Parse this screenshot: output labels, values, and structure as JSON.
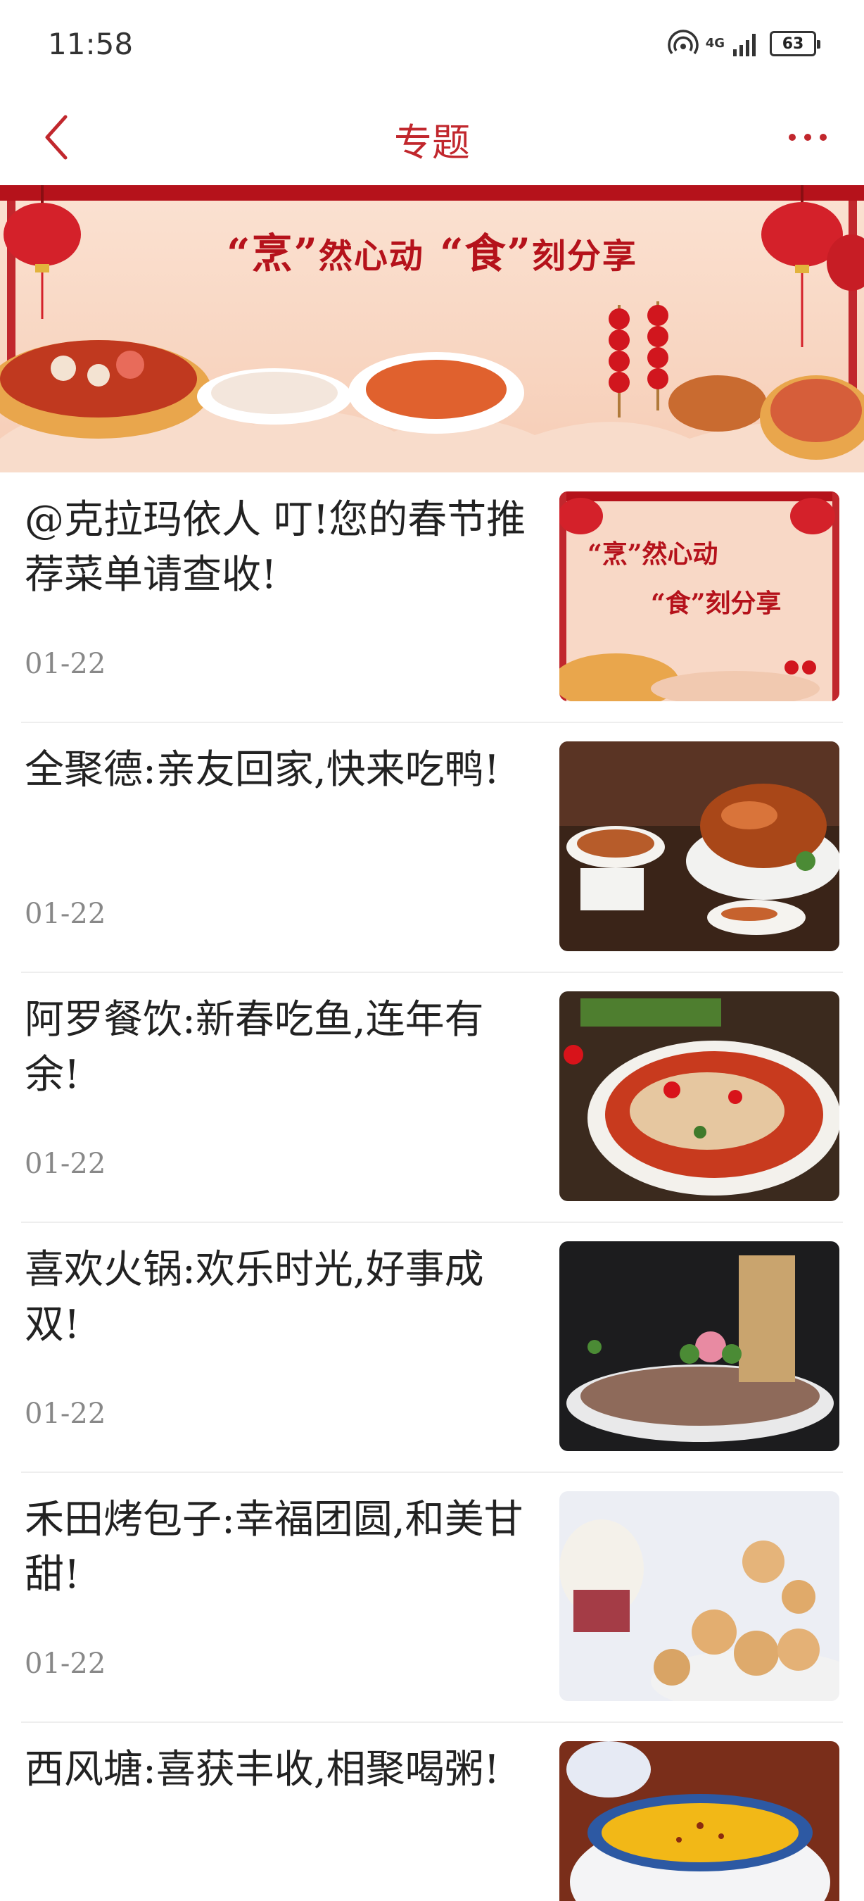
{
  "status_bar": {
    "time": "11:58",
    "network": "4G",
    "battery": "63"
  },
  "nav": {
    "title": "专题",
    "back_icon": "chevron-left-icon",
    "more_icon": "more-dots-icon"
  },
  "banner": {
    "text_a": "“烹”",
    "text_b": "然心动",
    "text_c": "“食”",
    "text_d": "刻分享"
  },
  "articles": [
    {
      "title": "@克拉玛依人 叮!您的春节推荐菜单请查收!",
      "date": "01-22",
      "thumb_line1": "“烹”然心动",
      "thumb_line2": "“食”刻分享"
    },
    {
      "title": "全聚德:亲友回家,快来吃鸭!",
      "date": "01-22"
    },
    {
      "title": "阿罗餐饮:新春吃鱼,连年有余!",
      "date": "01-22"
    },
    {
      "title": "喜欢火锅:欢乐时光,好事成双!",
      "date": "01-22"
    },
    {
      "title": "禾田烤包子:幸福团圆,和美甘甜!",
      "date": "01-22"
    },
    {
      "title": "西风塘:喜获丰收,相聚喝粥!",
      "date": ""
    }
  ],
  "colors": {
    "accent": "#c1272d",
    "text": "#222222",
    "muted": "#888888"
  }
}
